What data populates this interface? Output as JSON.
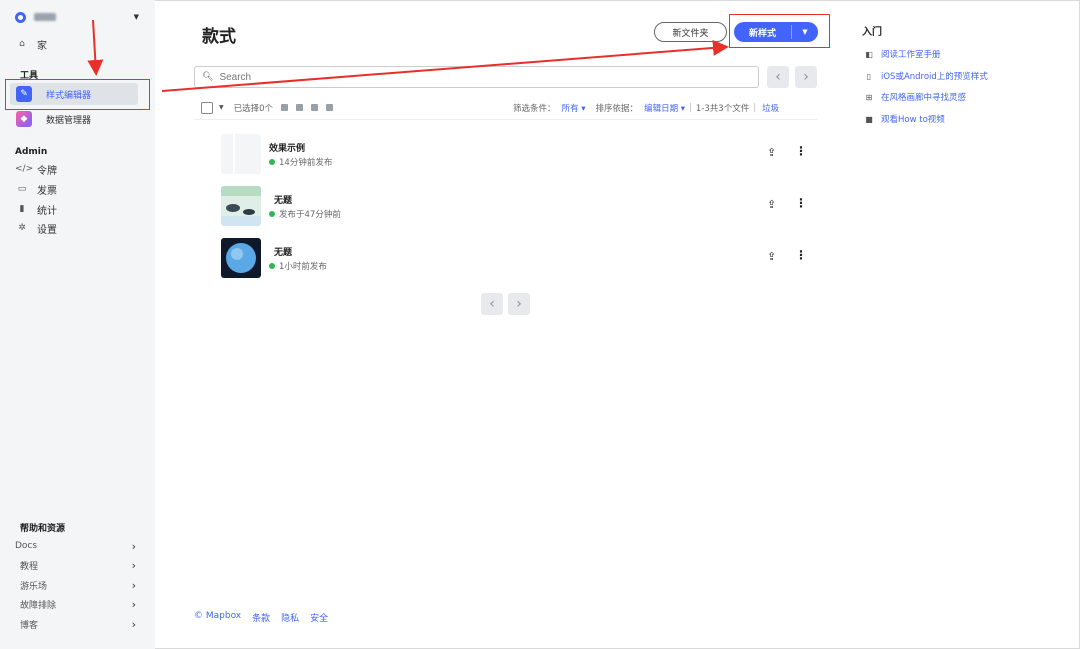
{
  "sidebar": {
    "home_label": "家",
    "tools_title": "工具",
    "tools": [
      {
        "label": "样式编辑器",
        "icon": "brush-icon"
      },
      {
        "label": "数据管理器",
        "icon": "data-manager-icon"
      }
    ],
    "admin_title": "Admin",
    "admin_items": [
      {
        "label": "令牌",
        "icon": "code-icon"
      },
      {
        "label": "发票",
        "icon": "invoice-icon"
      },
      {
        "label": "统计",
        "icon": "stats-icon"
      },
      {
        "label": "设置",
        "icon": "gear-icon"
      }
    ],
    "help_title": "帮助和资源",
    "help_items": [
      "Docs",
      "教程",
      "游乐场",
      "故障排除",
      "博客"
    ]
  },
  "main": {
    "title": "款式",
    "new_folder_label": "新文件夹",
    "new_style_label": "新样式",
    "search_placeholder": "Search",
    "filter": {
      "selected": "已选择0个",
      "filter_label": "筛选条件：",
      "filter_value": "所有",
      "sort_label": "排序依据：",
      "sort_value": "编辑日期",
      "count": "1-3共3个文件",
      "trash": "垃圾"
    },
    "styles": [
      {
        "name": "效果示例",
        "status": "14分钟前发布"
      },
      {
        "name": "无题",
        "status": "发布于47分钟前"
      },
      {
        "name": "无题",
        "status": "1小时前发布"
      }
    ],
    "footer": [
      "© Mapbox",
      "条款",
      "隐私",
      "安全"
    ]
  },
  "right_panel": {
    "title": "入门",
    "links": [
      {
        "label": "阅读工作室手册",
        "icon": "book-icon"
      },
      {
        "label": "iOS或Android上的预览样式",
        "icon": "phone-icon"
      },
      {
        "label": "在风格画廊中寻找灵感",
        "icon": "gallery-icon"
      },
      {
        "label": "观看How to视频",
        "icon": "video-icon"
      }
    ]
  },
  "colors": {
    "accent": "#4264fb",
    "annotation": "#e8302a",
    "published": "#33b35a"
  }
}
